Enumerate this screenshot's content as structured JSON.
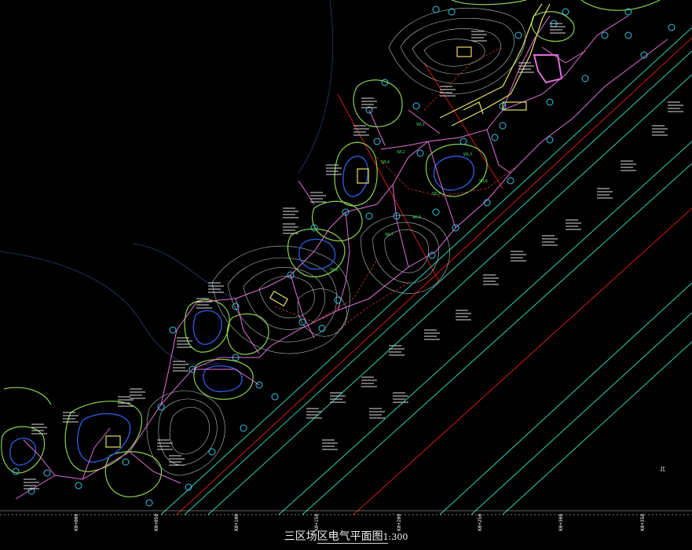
{
  "drawing": {
    "title": "三区场区电气平面图",
    "scale": "1:300",
    "north_mark": "北"
  },
  "stations": [
    "K0+000",
    "K0+050",
    "K0+100",
    "K0+150",
    "K0+200",
    "K0+250",
    "K0+300",
    "K0+350"
  ],
  "circuit_labels": [
    "WL1",
    "WL2",
    "WL3",
    "WL4",
    "WL5",
    "WL6",
    "WL7",
    "WL8",
    "WL9"
  ],
  "colors": {
    "background": "#000000",
    "road_lines": "#2fd1b5",
    "red_line": "#d21a1a",
    "contours": "#cfeee6",
    "islands": "#8ad14f",
    "cable": "#e070d8",
    "buildings": "#e6e06a",
    "lamps": "#36c6e6"
  }
}
